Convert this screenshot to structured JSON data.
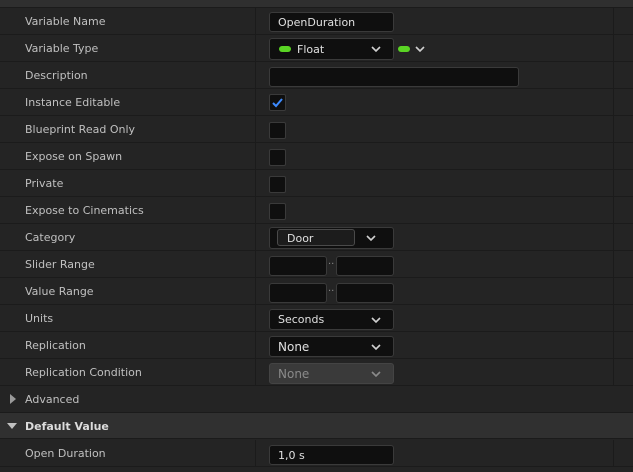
{
  "rows": {
    "variable_name": {
      "label": "Variable Name",
      "value": "OpenDuration"
    },
    "variable_type": {
      "label": "Variable Type",
      "value": "Float"
    },
    "description": {
      "label": "Description",
      "value": ""
    },
    "instance_editable": {
      "label": "Instance Editable",
      "checked": true
    },
    "blueprint_read_only": {
      "label": "Blueprint Read Only",
      "checked": false
    },
    "expose_on_spawn": {
      "label": "Expose on Spawn",
      "checked": false
    },
    "private": {
      "label": "Private",
      "checked": false
    },
    "expose_to_cinematics": {
      "label": "Expose to Cinematics",
      "checked": false
    },
    "category": {
      "label": "Category",
      "value": "Door"
    },
    "slider_range": {
      "label": "Slider Range",
      "min": "",
      "max": "",
      "separator": ".."
    },
    "value_range": {
      "label": "Value Range",
      "min": "",
      "max": "",
      "separator": ".."
    },
    "units": {
      "label": "Units",
      "value": "Seconds"
    },
    "replication": {
      "label": "Replication",
      "value": "None"
    },
    "replication_condition": {
      "label": "Replication Condition",
      "value": "None"
    }
  },
  "sections": {
    "advanced": {
      "label": "Advanced",
      "expanded": false
    },
    "default_value": {
      "label": "Default Value",
      "expanded": true
    }
  },
  "default_value": {
    "open_duration": {
      "label": "Open Duration",
      "value": "1,0 s"
    }
  },
  "colors": {
    "float_pin": "#5ad424",
    "checkmark": "#3d8bff"
  },
  "icons": [
    "chevron-down-icon",
    "float-pin-icon",
    "checkmark-icon",
    "expand-arrow-icon"
  ]
}
